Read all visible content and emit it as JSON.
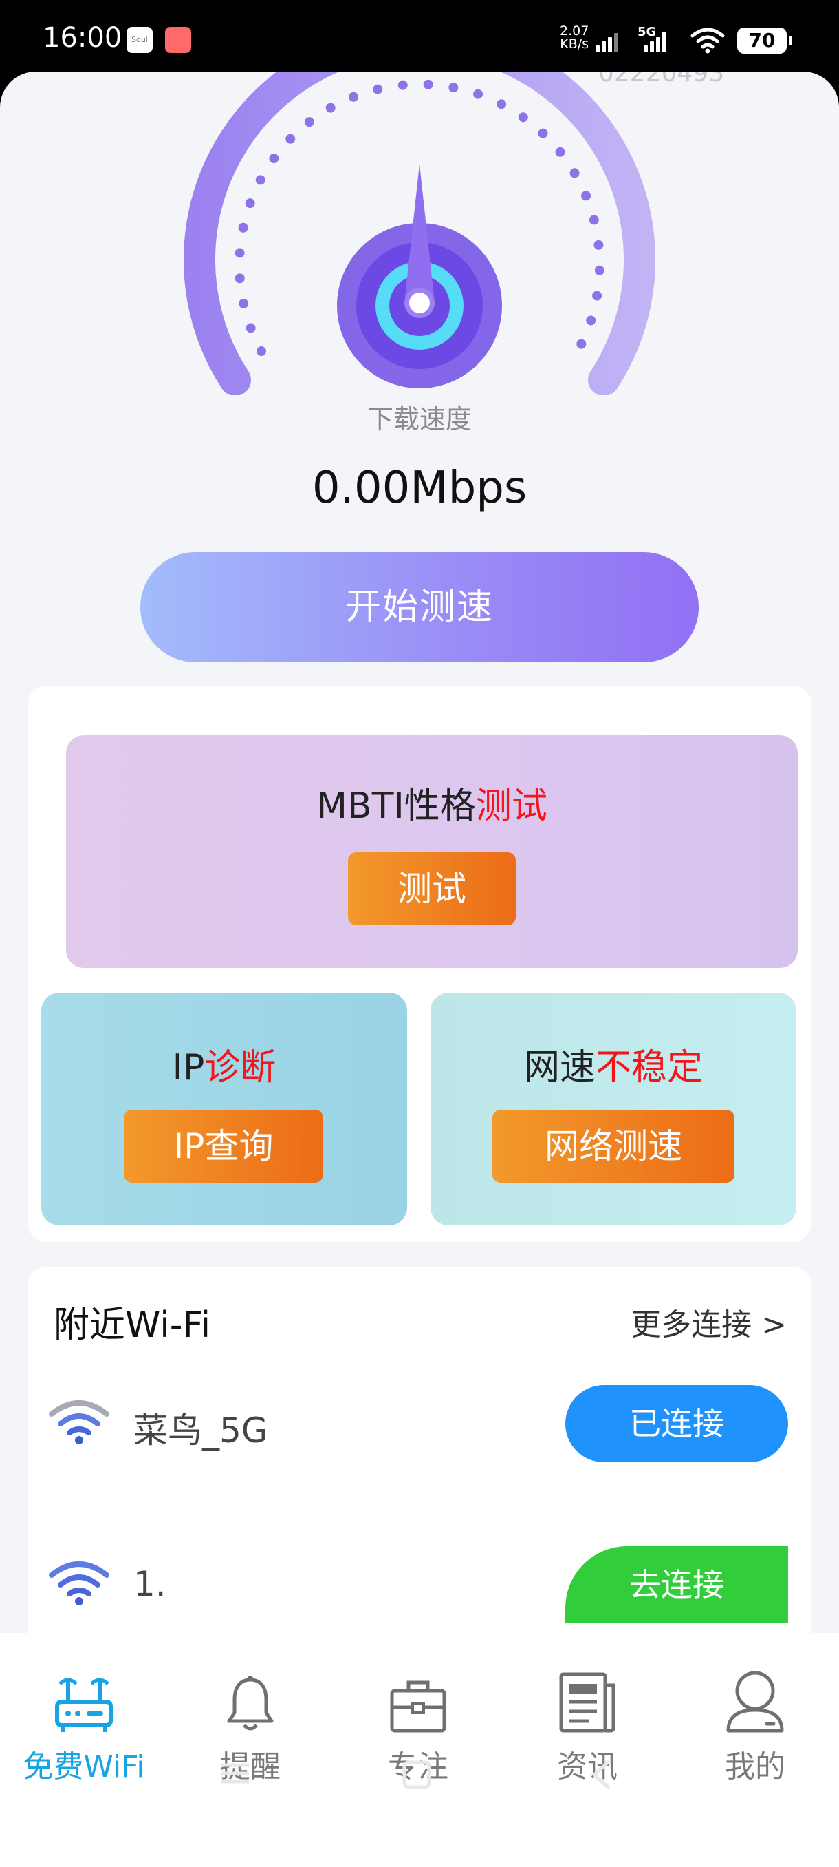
{
  "status_bar": {
    "time": "16:00",
    "app_icon_1": "Soul",
    "network_speed_value": "2.07",
    "network_speed_unit": "KB/s",
    "network_type": "5G",
    "battery": "70"
  },
  "speed_test": {
    "partial_top_text": "02220493",
    "label": "下载速度",
    "value": "0.00Mbps",
    "start_button": "开始测速"
  },
  "mbti": {
    "title_prefix": "MBTI性格",
    "title_highlight": "测试",
    "button": "测试"
  },
  "ip_card": {
    "title_prefix": "IP",
    "title_highlight": "诊断",
    "button": "IP查询"
  },
  "speed_card": {
    "title_prefix": "网速",
    "title_highlight": "不稳定",
    "button": "网络测速"
  },
  "nearby": {
    "title": "附近Wi-Fi",
    "more": "更多连接 >",
    "networks": [
      {
        "name": "菜鸟_5G",
        "action": "已连接"
      },
      {
        "name": "1.",
        "action": "去连接"
      }
    ]
  },
  "tabbar": {
    "items": [
      {
        "label": "免费WiFi",
        "icon": "router-icon",
        "active": true
      },
      {
        "label": "提醒",
        "icon": "bell-icon"
      },
      {
        "label": "专注",
        "icon": "briefcase-icon"
      },
      {
        "label": "资讯",
        "icon": "newspaper-icon"
      },
      {
        "label": "我的",
        "icon": "user-icon"
      }
    ]
  },
  "colors": {
    "accent_blue": "#1f93fb",
    "accent_green": "#32cd3a",
    "orange": "#ec6c17",
    "purple": "#9170f4",
    "highlight_red": "#f4141a",
    "tab_active": "#18a3e3"
  }
}
